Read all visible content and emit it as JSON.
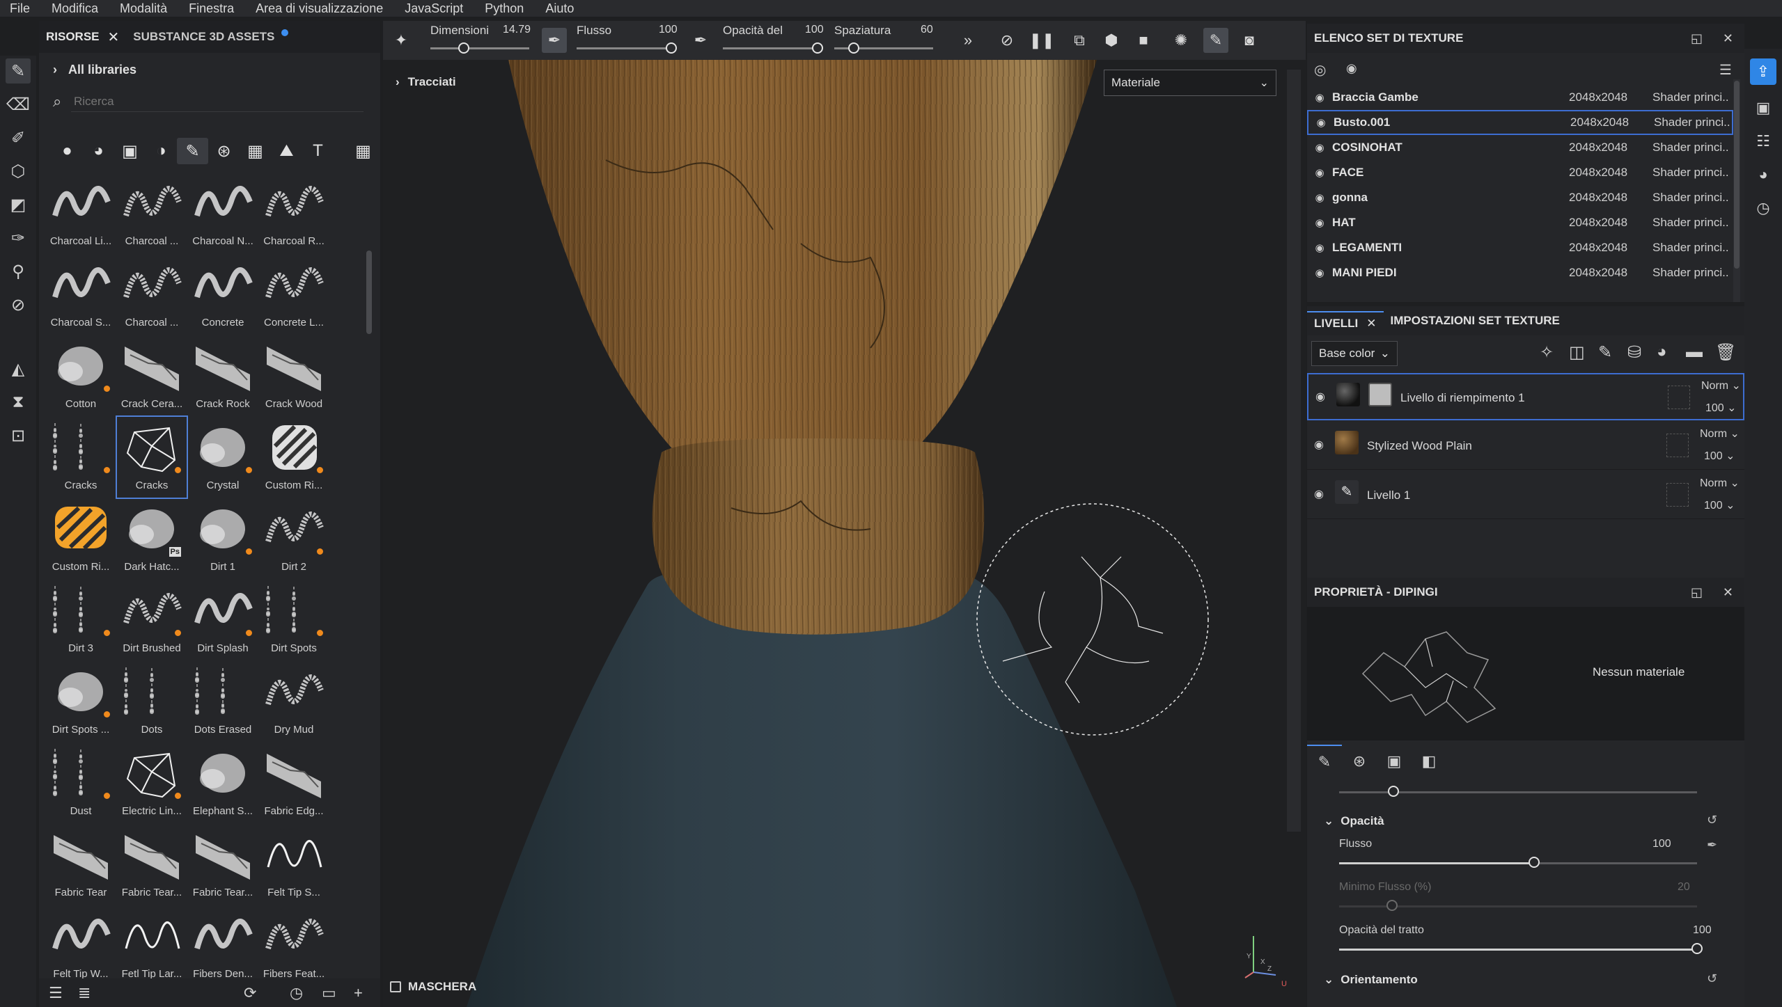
{
  "menu": [
    "File",
    "Modifica",
    "Modalità",
    "Finestra",
    "Area di visualizzazione",
    "JavaScript",
    "Python",
    "Aiuto"
  ],
  "assets": {
    "tab_resources": "RISORSE",
    "tab_substance": "SUBSTANCE 3D ASSETS",
    "all_libraries": "All libraries",
    "search_placeholder": "Ricerca",
    "brushes": [
      {
        "label": "Charcoal Li...",
        "kind": "wave",
        "badge": false
      },
      {
        "label": "Charcoal ...",
        "kind": "wave",
        "badge": false
      },
      {
        "label": "Charcoal N...",
        "kind": "wave",
        "badge": false
      },
      {
        "label": "Charcoal R...",
        "kind": "wave",
        "badge": false
      },
      {
        "label": "Charcoal S...",
        "kind": "wave",
        "badge": false
      },
      {
        "label": "Charcoal ...",
        "kind": "wave",
        "badge": false
      },
      {
        "label": "Concrete",
        "kind": "wave",
        "badge": false
      },
      {
        "label": "Concrete L...",
        "kind": "wave",
        "badge": false
      },
      {
        "label": "Cotton",
        "kind": "blob",
        "badge": true
      },
      {
        "label": "Crack Cera...",
        "kind": "crack",
        "badge": false
      },
      {
        "label": "Crack Rock",
        "kind": "crack",
        "badge": false
      },
      {
        "label": "Crack Wood",
        "kind": "crack",
        "badge": false
      },
      {
        "label": "Cracks",
        "kind": "spots",
        "badge": true
      },
      {
        "label": "Cracks",
        "kind": "web",
        "badge": true
      },
      {
        "label": "Crystal",
        "kind": "blob",
        "badge": true
      },
      {
        "label": "Custom Ri...",
        "kind": "hatch",
        "badge": true
      },
      {
        "label": "Custom Ri...",
        "kind": "hatch-orange",
        "badge": false
      },
      {
        "label": "Dark Hatc...",
        "kind": "blob",
        "badge": false,
        "ps": "Ps"
      },
      {
        "label": "Dirt 1",
        "kind": "blob",
        "badge": true
      },
      {
        "label": "Dirt 2",
        "kind": "wave",
        "badge": true
      },
      {
        "label": "Dirt 3",
        "kind": "spots",
        "badge": true
      },
      {
        "label": "Dirt Brushed",
        "kind": "wave",
        "badge": true
      },
      {
        "label": "Dirt Splash",
        "kind": "wave",
        "badge": true
      },
      {
        "label": "Dirt Spots",
        "kind": "spots",
        "badge": true
      },
      {
        "label": "Dirt Spots ...",
        "kind": "blob",
        "badge": true
      },
      {
        "label": "Dots",
        "kind": "spots",
        "badge": false
      },
      {
        "label": "Dots Erased",
        "kind": "spots",
        "badge": false
      },
      {
        "label": "Dry Mud",
        "kind": "wave",
        "badge": false
      },
      {
        "label": "Dust",
        "kind": "spots",
        "badge": true
      },
      {
        "label": "Electric Lin...",
        "kind": "web",
        "badge": true
      },
      {
        "label": "Elephant S...",
        "kind": "blob",
        "badge": false
      },
      {
        "label": "Fabric Edg...",
        "kind": "crack",
        "badge": false
      },
      {
        "label": "Fabric Tear",
        "kind": "crack",
        "badge": false
      },
      {
        "label": "Fabric Tear...",
        "kind": "crack",
        "badge": false
      },
      {
        "label": "Fabric Tear...",
        "kind": "crack",
        "badge": false
      },
      {
        "label": "Felt Tip S...",
        "kind": "line",
        "badge": false
      },
      {
        "label": "Felt Tip W...",
        "kind": "wave",
        "badge": false
      },
      {
        "label": "Fetl Tip Lar...",
        "kind": "line",
        "badge": false
      },
      {
        "label": "Fibers Den...",
        "kind": "wave",
        "badge": false
      },
      {
        "label": "Fibers Feat...",
        "kind": "wave",
        "badge": false
      }
    ],
    "selected_index": 13
  },
  "toolbar": {
    "size_label": "Dimensioni",
    "size_value": "14.79",
    "flow_label": "Flusso",
    "flow_value": "100",
    "opacity_label": "Opacità del",
    "opacity_value": "100",
    "spacing_label": "Spaziatura",
    "spacing_value": "60"
  },
  "viewport": {
    "paths_label": "Tracciati",
    "material_select": "Materiale",
    "mask_label": "MASCHERA",
    "gizmo_y": "Y",
    "gizmo_x": "X",
    "gizmo_z": "Z",
    "gizmo_u": "U"
  },
  "texture_sets": {
    "title": "ELENCO SET DI TEXTURE",
    "rows": [
      {
        "name": "Braccia Gambe",
        "res": "2048x2048",
        "shader": "Shader princi..."
      },
      {
        "name": "Busto.001",
        "res": "2048x2048",
        "shader": "Shader princi..."
      },
      {
        "name": "COSINOHAT",
        "res": "2048x2048",
        "shader": "Shader princi..."
      },
      {
        "name": "FACE",
        "res": "2048x2048",
        "shader": "Shader princi..."
      },
      {
        "name": "gonna",
        "res": "2048x2048",
        "shader": "Shader princi..."
      },
      {
        "name": "HAT",
        "res": "2048x2048",
        "shader": "Shader princi..."
      },
      {
        "name": "LEGAMENTI",
        "res": "2048x2048",
        "shader": "Shader princi..."
      },
      {
        "name": "MANI PIEDI",
        "res": "2048x2048",
        "shader": "Shader princi..."
      }
    ],
    "selected_index": 1
  },
  "layers": {
    "tab_layers": "LIVELLI",
    "tab_settings": "IMPOSTAZIONI SET TEXTURE",
    "channel": "Base color",
    "items": [
      {
        "name": "Livello di riempimento 1",
        "blend": "Norm",
        "opacity": "100"
      },
      {
        "name": "Stylized Wood Plain",
        "blend": "Norm",
        "opacity": "100"
      },
      {
        "name": "Livello 1",
        "blend": "Norm",
        "opacity": "100"
      }
    ]
  },
  "properties": {
    "title": "PROPRIETÀ - DIPINGI",
    "no_material": "Nessun materiale",
    "opacity_section": "Opacità",
    "flow_label": "Flusso",
    "flow_value": "100",
    "flow_level": 1.0,
    "min_flow_label": "Minimo Flusso (%)",
    "min_flow_value": "20",
    "min_flow_level": 0.2,
    "stroke_opacity_label": "Opacità del tratto",
    "stroke_opacity_value": "100",
    "stroke_opacity_level": 1.0,
    "orientation_section": "Orientamento"
  }
}
